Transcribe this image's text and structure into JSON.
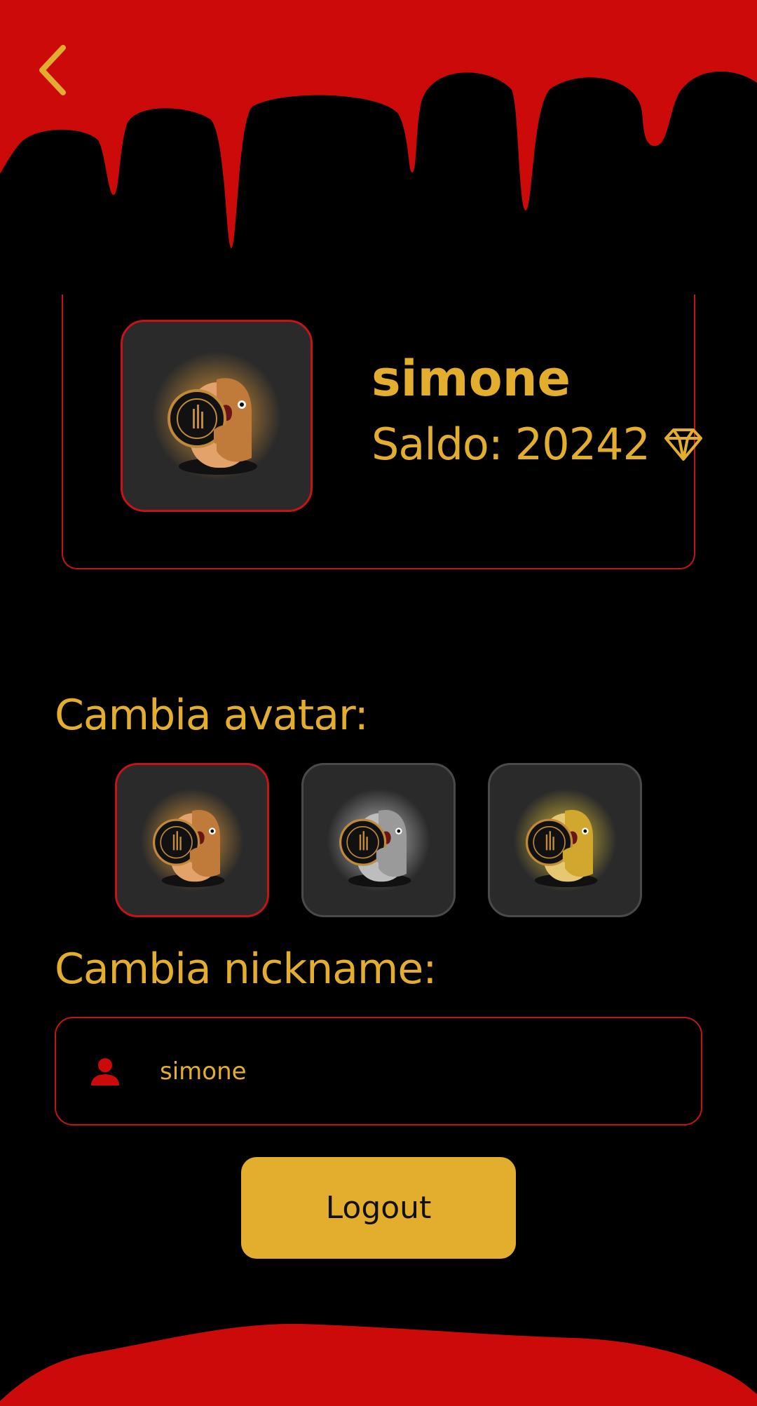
{
  "icons": {
    "back": "chevron-left-icon",
    "balance": "gem-icon",
    "nickname": "person-icon"
  },
  "colors": {
    "background": "#000000",
    "accent_red": "#cc0a0a",
    "accent_gold": "#e3ae2e",
    "card_border": "#c4141a",
    "tile_bg": "#2a2a2a"
  },
  "profile": {
    "username": "simone",
    "balance_label": "Saldo:",
    "balance_value": "20242",
    "avatar_variant": "orange"
  },
  "avatar_section": {
    "title": "Cambia avatar:",
    "options": [
      {
        "variant": "orange",
        "selected": true
      },
      {
        "variant": "silver",
        "selected": false
      },
      {
        "variant": "gold",
        "selected": false
      }
    ]
  },
  "nickname_section": {
    "title": "Cambia nickname:",
    "value": "simone"
  },
  "logout": {
    "label": "Logout"
  }
}
